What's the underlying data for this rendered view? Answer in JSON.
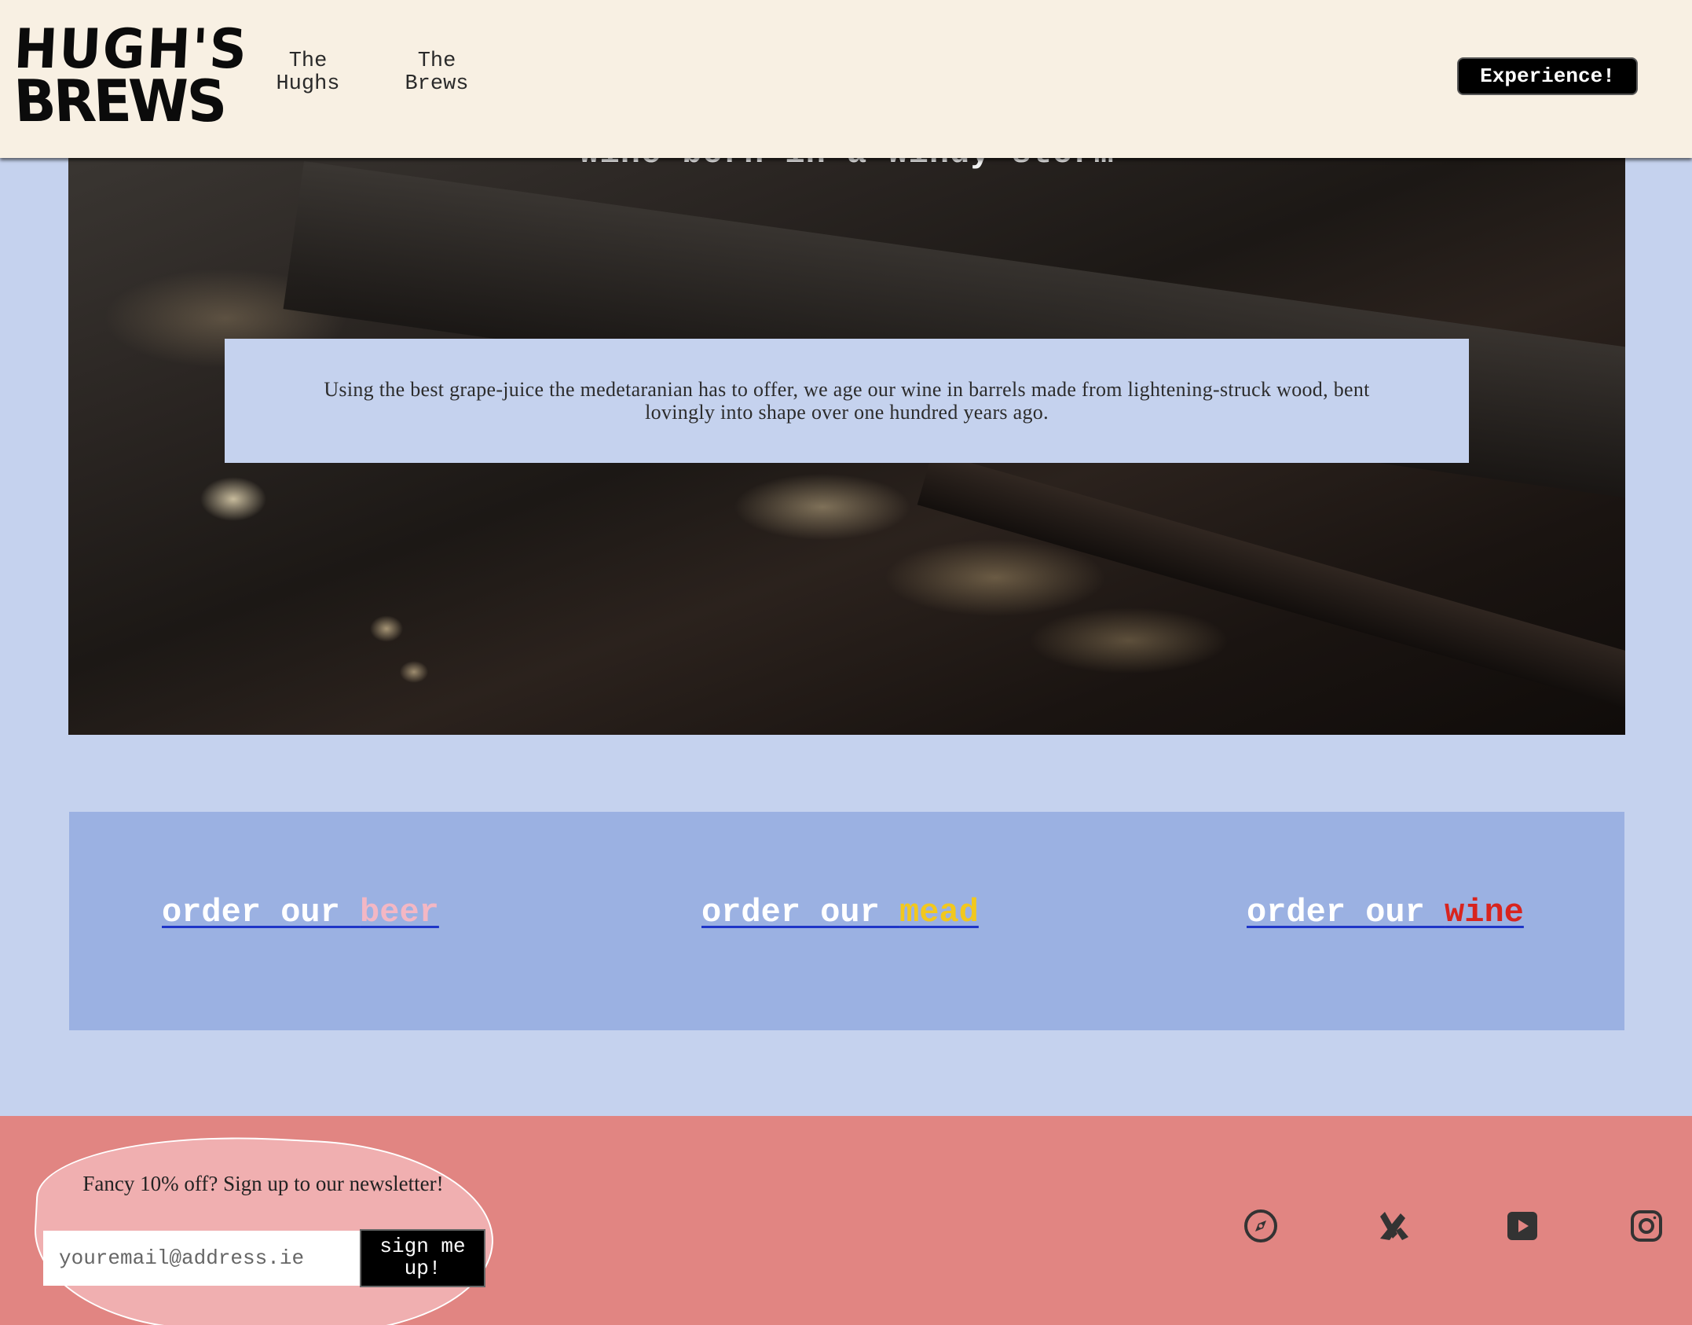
{
  "header": {
    "logo_line1": "HUGH'S",
    "logo_line2": "BREWS",
    "nav": [
      {
        "line1": "The",
        "line2": "Hughs"
      },
      {
        "line1": "The",
        "line2": "Brews"
      }
    ],
    "cta_label": "Experience!"
  },
  "hero": {
    "title": "Wine born in a windy storm",
    "description": "Using the best grape-juice the medetaranian has to offer, we age our wine in barrels made from lightening-struck wood, bent lovingly into shape over one hundred years ago."
  },
  "order": {
    "prefix": "order our ",
    "links": [
      {
        "product": "beer",
        "color": "#f3b7c4"
      },
      {
        "product": "mead",
        "color": "#f2c81d"
      },
      {
        "product": "wine",
        "color": "#d8241e"
      }
    ],
    "underline_color": "#1e35c8"
  },
  "newsletter": {
    "text": "Fancy 10% off? Sign up to our newsletter!",
    "placeholder": "youremail@address.ie",
    "button_label": "sign me up!"
  },
  "social": [
    "compass-icon",
    "tools-icon",
    "youtube-icon",
    "instagram-icon"
  ],
  "colors": {
    "page_bg": "#c5d2ee",
    "header_bg": "#f8f0e3",
    "order_band_bg": "#9bb1e2",
    "footer_bg": "#e18582",
    "newsletter_blob": "#f0afb0"
  }
}
